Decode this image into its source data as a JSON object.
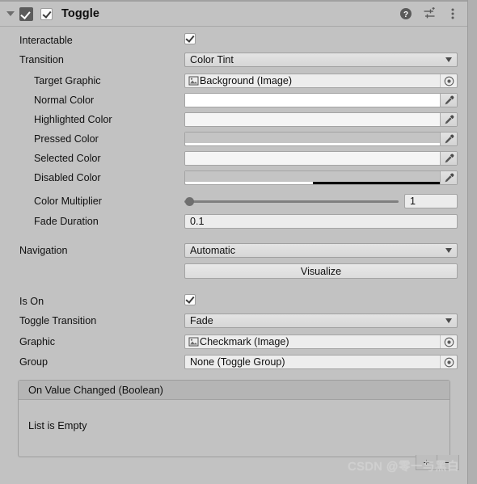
{
  "header": {
    "title": "Toggle",
    "enabled": true,
    "foldout_expanded": true,
    "icons": [
      "help-icon",
      "preset-icon",
      "more-menu-icon"
    ]
  },
  "rows": {
    "interactable": {
      "label": "Interactable",
      "checked": true
    },
    "transition": {
      "label": "Transition",
      "value": "Color Tint"
    },
    "target_graphic": {
      "label": "Target Graphic",
      "value": "Background (Image)"
    },
    "normal_color": {
      "label": "Normal Color",
      "color": "#ffffff",
      "alpha_pct": 100
    },
    "highlighted_color": {
      "label": "Highlighted Color",
      "color": "#f5f5f5",
      "alpha_pct": 100
    },
    "pressed_color": {
      "label": "Pressed Color",
      "color": "#c4c4c4",
      "alpha_pct": 100
    },
    "selected_color": {
      "label": "Selected Color",
      "color": "#f5f5f5",
      "alpha_pct": 100
    },
    "disabled_color": {
      "label": "Disabled Color",
      "color": "#c4c4c4",
      "alpha_pct": 50
    },
    "color_multiplier": {
      "label": "Color Multiplier",
      "value": "1",
      "slider_pct": 0
    },
    "fade_duration": {
      "label": "Fade Duration",
      "value": "0.1"
    },
    "navigation": {
      "label": "Navigation",
      "value": "Automatic"
    },
    "visualize": {
      "label": "Visualize"
    },
    "is_on": {
      "label": "Is On",
      "checked": true
    },
    "toggle_transition": {
      "label": "Toggle Transition",
      "value": "Fade"
    },
    "graphic": {
      "label": "Graphic",
      "value": "Checkmark (Image)"
    },
    "group": {
      "label": "Group",
      "value": "None (Toggle Group)"
    }
  },
  "event_panel": {
    "title": "On Value Changed (Boolean)",
    "empty_text": "List is Empty",
    "add_label": "+",
    "remove_label": "−"
  },
  "watermark": "CSDN @零一与黑白",
  "colors": {
    "panel_bg": "#c2c2c2",
    "field_bg": "#ececec",
    "dropdown_bg": "#e0e0e0",
    "text": "#101010"
  }
}
